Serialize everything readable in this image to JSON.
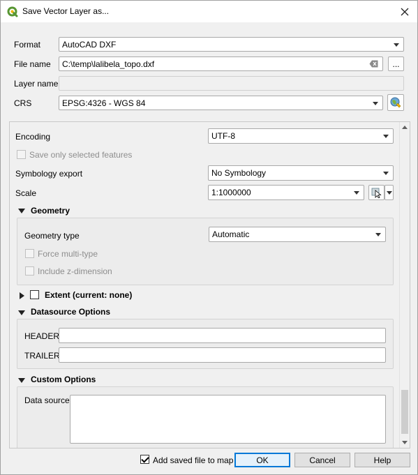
{
  "window": {
    "title": "Save Vector Layer as..."
  },
  "form": {
    "format_label": "Format",
    "format_value": "AutoCAD DXF",
    "filename_label": "File name",
    "filename_value": "C:\\temp\\lalibela_topo.dxf",
    "browse_label": "...",
    "layername_label": "Layer name",
    "layername_value": "",
    "crs_label": "CRS",
    "crs_value": "EPSG:4326 - WGS 84"
  },
  "options": {
    "encoding_label": "Encoding",
    "encoding_value": "UTF-8",
    "save_selected_label": "Save only selected features",
    "save_selected_checked": false,
    "symbology_label": "Symbology export",
    "symbology_value": "No Symbology",
    "scale_label": "Scale",
    "scale_value": "1:1000000"
  },
  "geometry": {
    "title": "Geometry",
    "type_label": "Geometry type",
    "type_value": "Automatic",
    "force_multi_label": "Force multi-type",
    "include_z_label": "Include z-dimension"
  },
  "extent": {
    "title": "Extent (current: none)",
    "checked": false
  },
  "datasource": {
    "title": "Datasource Options",
    "header_label": "HEADER",
    "header_value": "",
    "trailer_label": "TRAILER",
    "trailer_value": ""
  },
  "custom": {
    "title": "Custom Options",
    "data_source_label": "Data source",
    "data_source_value": ""
  },
  "footer": {
    "add_to_map_label": "Add saved file to map",
    "add_to_map_checked": true,
    "ok_label": "OK",
    "cancel_label": "Cancel",
    "help_label": "Help"
  },
  "colors": {
    "accent": "#0078d7",
    "qgis_green": "#589632"
  }
}
